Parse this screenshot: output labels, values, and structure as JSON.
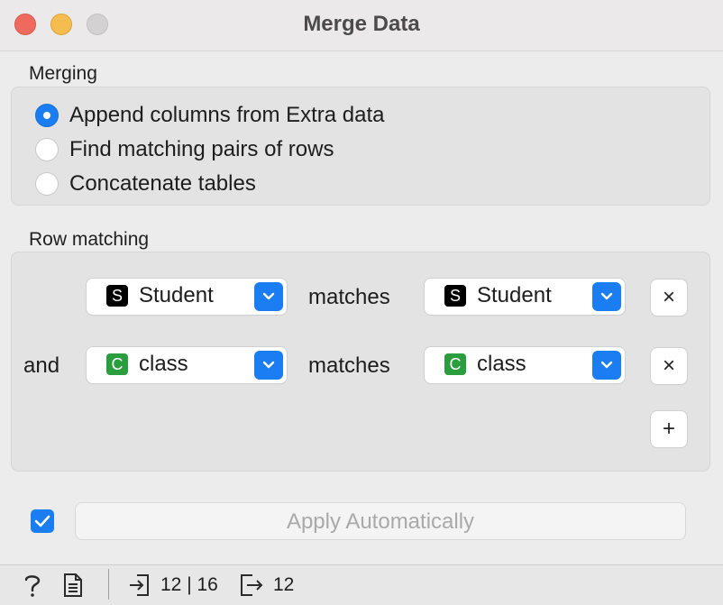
{
  "window": {
    "title": "Merge Data",
    "traffic_lights": {
      "close_color": "#ee6a5e",
      "minimize_color": "#f5bd4f",
      "zoom_color": "#d3d1d2"
    }
  },
  "merging": {
    "section_label": "Merging",
    "options": [
      {
        "label": "Append columns from Extra data",
        "checked": true
      },
      {
        "label": "Find matching pairs of rows",
        "checked": false
      },
      {
        "label": "Concatenate tables",
        "checked": false
      }
    ]
  },
  "row_matching": {
    "section_label": "Row matching",
    "connector_word": "and",
    "matches_word": "matches",
    "rows": [
      {
        "left": {
          "type_letter": "S",
          "type_color": "#000000",
          "value": "Student"
        },
        "right": {
          "type_letter": "S",
          "type_color": "#000000",
          "value": "Student"
        },
        "remove_label": "×"
      },
      {
        "left": {
          "type_letter": "C",
          "type_color": "#2a9d3f",
          "value": "class"
        },
        "right": {
          "type_letter": "C",
          "type_color": "#2a9d3f",
          "value": "class"
        },
        "remove_label": "×"
      }
    ],
    "add_label": "+"
  },
  "apply": {
    "checkbox_checked": true,
    "button_label": "Apply Automatically"
  },
  "statusbar": {
    "help_icon": "help-icon",
    "report_icon": "report-icon",
    "input_icon": "input-icon",
    "input_counts": "12 | 16",
    "output_icon": "output-icon",
    "output_count": "12"
  },
  "colors": {
    "accent": "#1a7df2"
  }
}
